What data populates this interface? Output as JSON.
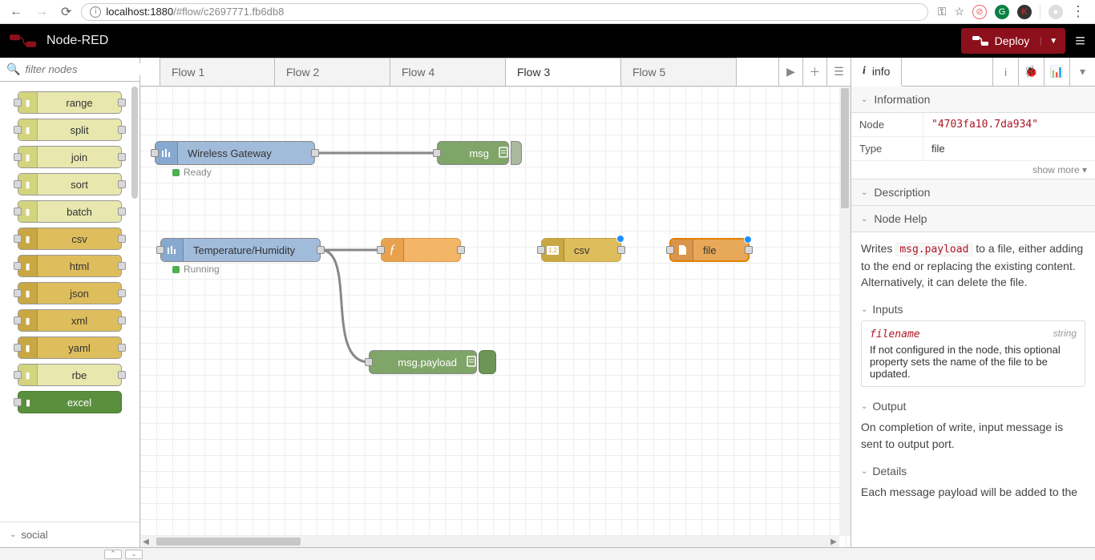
{
  "browser": {
    "url_host": "localhost",
    "url_port": ":1880",
    "url_path": "/#flow/c2697771.fb6db8"
  },
  "header": {
    "title": "Node-RED",
    "deploy_label": "Deploy"
  },
  "palette": {
    "filter_placeholder": "filter nodes",
    "nodes": [
      {
        "label": "range",
        "style": "pn-yellow",
        "in": true,
        "out": true
      },
      {
        "label": "split",
        "style": "pn-yellow",
        "in": true,
        "out": true
      },
      {
        "label": "join",
        "style": "pn-yellow",
        "in": true,
        "out": true
      },
      {
        "label": "sort",
        "style": "pn-yellow",
        "in": true,
        "out": true
      },
      {
        "label": "batch",
        "style": "pn-yellow",
        "in": true,
        "out": true
      },
      {
        "label": "csv",
        "style": "pn-tan",
        "in": true,
        "out": true
      },
      {
        "label": "html",
        "style": "pn-tan",
        "in": true,
        "out": true
      },
      {
        "label": "json",
        "style": "pn-tan",
        "in": true,
        "out": true
      },
      {
        "label": "xml",
        "style": "pn-tan",
        "in": true,
        "out": true
      },
      {
        "label": "yaml",
        "style": "pn-tan",
        "in": true,
        "out": true
      },
      {
        "label": "rbe",
        "style": "pn-yellow",
        "in": true,
        "out": true
      },
      {
        "label": "excel",
        "style": "pn-green",
        "in": true,
        "out": false
      }
    ],
    "category": "social"
  },
  "tabs": {
    "items": [
      "Flow 1",
      "Flow 2",
      "Flow 4",
      "Flow 3",
      "Flow 5"
    ],
    "active_index": 3
  },
  "canvas": {
    "n_gateway": "Wireless Gateway",
    "n_gateway_status": "Ready",
    "n_msg": "msg",
    "n_th": "Temperature/Humidity",
    "n_th_status": "Running",
    "n_payload": "msg.payload",
    "n_csv": "csv",
    "n_file": "file"
  },
  "sidebar": {
    "tab_label": "info",
    "sec_information": "Information",
    "kv_node_k": "Node",
    "kv_node_v": "\"4703fa10.7da934\"",
    "kv_type_k": "Type",
    "kv_type_v": "file",
    "show_more": "show more ▾",
    "sec_description": "Description",
    "sec_nodehelp": "Node Help",
    "help_intro_pre": "Writes ",
    "help_intro_code": "msg.payload",
    "help_intro_post": " to a file, either adding to the end or replacing the existing content. Alternatively, it can delete the file.",
    "sub_inputs": "Inputs",
    "input_prop": "filename",
    "input_type": "string",
    "input_desc": "If not configured in the node, this optional property sets the name of the file to be updated.",
    "sub_output": "Output",
    "output_desc": "On completion of write, input message is sent to output port.",
    "sub_details": "Details",
    "details_desc": "Each message payload will be added to the"
  }
}
